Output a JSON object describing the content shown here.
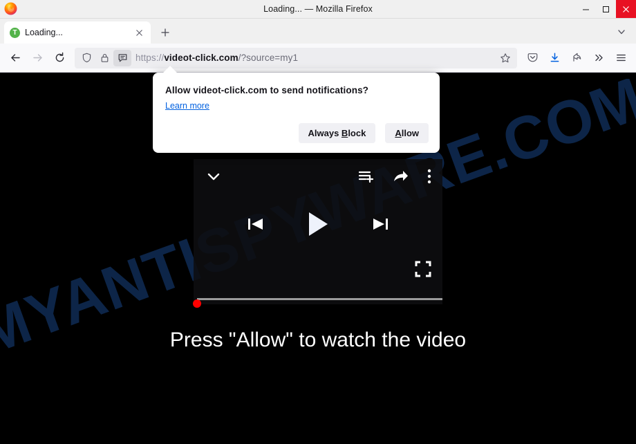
{
  "window": {
    "title": "Loading... — Mozilla Firefox",
    "controls": {
      "minimize": "minimize",
      "maximize": "maximize",
      "close": "close"
    }
  },
  "tabs": {
    "active": {
      "favicon_letter": "T",
      "title": "Loading...",
      "close_label": "×"
    },
    "new_tab_label": "+",
    "list_all_tabs_label": "v"
  },
  "navigation": {
    "back_label": "Back",
    "forward_label": "Forward",
    "reload_label": "Reload",
    "identity_icons": [
      "shield-icon",
      "lock-icon",
      "notification-permission-icon"
    ],
    "url": {
      "scheme": "https://",
      "host": "videot-click.com",
      "path": "/?source=my1",
      "full": "https://videot-click.com/?source=my1"
    },
    "bookmark_label": "Bookmark this page",
    "toolbar_icons": [
      "pocket-icon",
      "downloads-icon",
      "account-icon",
      "overflow-icon",
      "app-menu-icon"
    ]
  },
  "permission_popup": {
    "heading": "Allow videot-click.com to send notifications?",
    "learn_more": "Learn more",
    "block_button": {
      "prefix": "Always ",
      "accesskey": "B",
      "suffix": "lock"
    },
    "allow_button": {
      "prefix": "",
      "accesskey": "A",
      "suffix": "llow"
    }
  },
  "page": {
    "background_color": "#000000",
    "watermark": "MYANTISPYWARE.COM",
    "watermark_color": "#0d2548",
    "cta_text": "Press \"Allow\" to watch the video",
    "cta_color": "#ffffff",
    "player": {
      "collapse_icon": "chevron-down-icon",
      "playlist_add_icon": "playlist-add-icon",
      "share_icon": "share-icon",
      "more_icon": "more-vertical-icon",
      "previous_icon": "previous-track-icon",
      "play_icon": "play-icon",
      "next_icon": "next-track-icon",
      "fullscreen_icon": "fullscreen-icon",
      "progress_percent": 0,
      "scrubber_color": "#ff0000",
      "track_color": "#9b9b9b"
    }
  }
}
